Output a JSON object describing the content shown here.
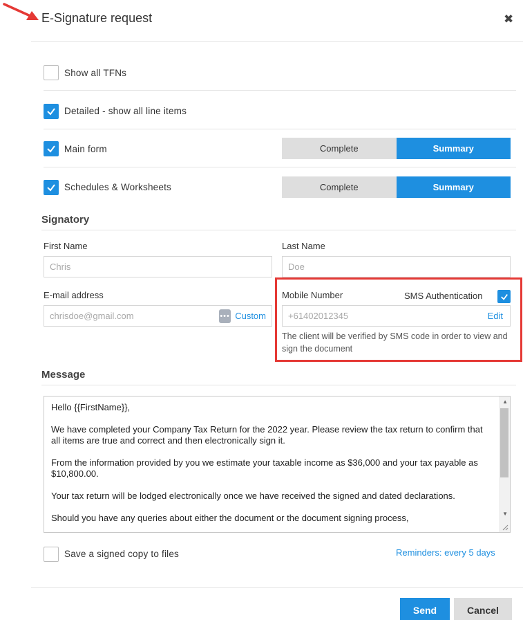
{
  "dialog": {
    "title": "E-Signature request",
    "close_glyph": "✖"
  },
  "options": {
    "show_all_tfns": {
      "label": "Show all TFNs",
      "checked": false
    },
    "detailed": {
      "label": "Detailed - show all line items",
      "checked": true
    },
    "main_form": {
      "label": "Main form",
      "checked": true,
      "segments": [
        "Complete",
        "Summary"
      ],
      "selected": "Summary"
    },
    "schedules": {
      "label": "Schedules & Worksheets",
      "checked": true,
      "segments": [
        "Complete",
        "Summary"
      ],
      "selected": "Summary"
    }
  },
  "signatory": {
    "heading": "Signatory",
    "first_name": {
      "label": "First Name",
      "placeholder": "Chris"
    },
    "last_name": {
      "label": "Last Name",
      "placeholder": "Doe"
    },
    "email": {
      "label": "E-mail address",
      "placeholder": "chrisdoe@gmail.com",
      "custom_label": "Custom",
      "dots_glyph": "•••"
    },
    "mobile": {
      "label": "Mobile Number",
      "placeholder": "+61402012345",
      "edit_label": "Edit"
    },
    "sms": {
      "label": "SMS Authentication",
      "checked": true
    },
    "sms_hint": "The client will be verified by SMS code in order to view and sign the document"
  },
  "message": {
    "heading": "Message",
    "paragraphs": [
      "Hello {{FirstName}},",
      "We have completed your Company Tax Return for the 2022 year. Please review the tax return to confirm that all items are true and correct and then electronically sign it.",
      "From the information provided by you we estimate your taxable income as $36,000 and your tax payable as $10,800.00.",
      "Your tax return will be lodged electronically once we have received the signed and dated declarations.",
      "Should you have any queries about either the document or the document signing process,"
    ]
  },
  "footer": {
    "save_copy": {
      "label": "Save a signed copy to files",
      "checked": false
    },
    "reminders_label": "Reminders: every 5 days",
    "send_label": "Send",
    "cancel_label": "Cancel"
  },
  "colors": {
    "accent": "#1e8fe0",
    "highlight": "#e53935"
  }
}
